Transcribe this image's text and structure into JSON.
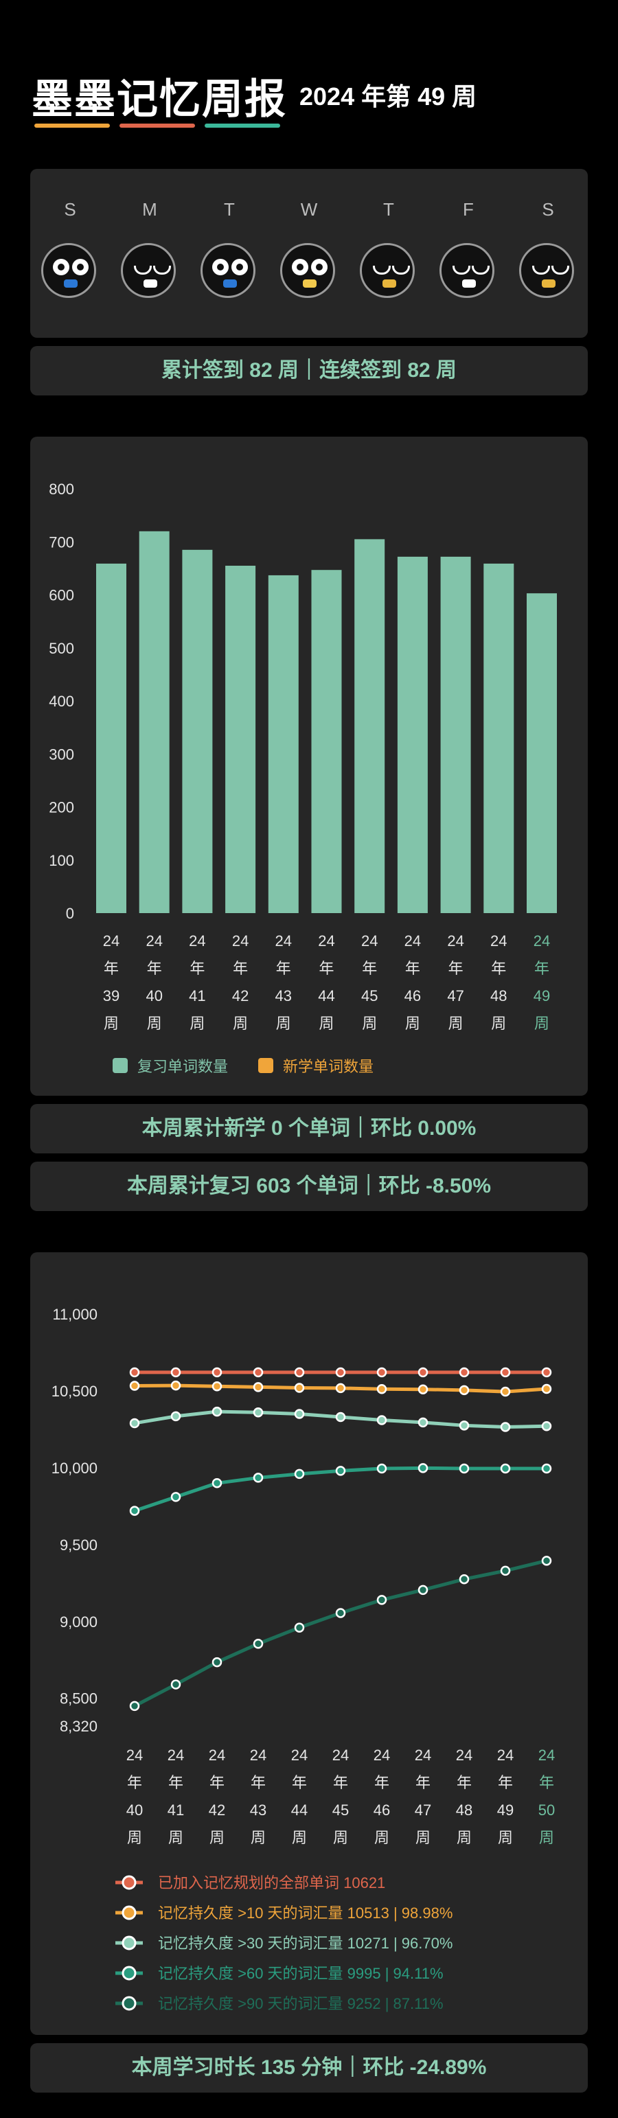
{
  "header": {
    "title": "墨墨记忆周报",
    "subtitle": "2024 年第 49 周"
  },
  "bar_colors": [
    "#f0a53a",
    "#e0664c",
    "#3bb89a"
  ],
  "week": {
    "days": [
      "S",
      "M",
      "T",
      "W",
      "T",
      "F",
      "S"
    ],
    "faces": [
      {
        "icon": "mask-face-icon",
        "eyes": "open",
        "accent": "#2b78d6"
      },
      {
        "icon": "squint-face-icon",
        "eyes": "closed",
        "accent": "#ffffff"
      },
      {
        "icon": "mask-face-icon",
        "eyes": "open",
        "accent": "#2b78d6"
      },
      {
        "icon": "wink-face-icon",
        "eyes": "open",
        "accent": "#f2c94c"
      },
      {
        "icon": "happy-face-icon",
        "eyes": "closed",
        "accent": "#e8b53c"
      },
      {
        "icon": "sleepy-face-icon",
        "eyes": "closed",
        "accent": "#ffffff"
      },
      {
        "icon": "happy-face-icon",
        "eyes": "closed",
        "accent": "#e8b53c"
      }
    ]
  },
  "streak": "累计签到 82 周｜连续签到 82 周",
  "summary_new": "本周累计新学 0 个单词｜环比 0.00%",
  "summary_review": "本周累计复习 603 个单词｜环比 -8.50%",
  "summary_time": "本周学习时长 135 分钟｜环比 -24.89%",
  "chart_data": [
    {
      "type": "bar",
      "categories": [
        "24年39周",
        "24年40周",
        "24年41周",
        "24年42周",
        "24年43周",
        "24年44周",
        "24年45周",
        "24年46周",
        "24年47周",
        "24年48周",
        "24年49周"
      ],
      "series": [
        {
          "name": "复习单词数量",
          "values": [
            659,
            720,
            685,
            655,
            637,
            647,
            705,
            672,
            672,
            659,
            603
          ],
          "color": "#82c4aa"
        },
        {
          "name": "新学单词数量",
          "values": [
            0,
            0,
            0,
            0,
            0,
            0,
            0,
            0,
            0,
            0,
            0
          ],
          "color": "#f0a53a"
        }
      ],
      "yticks": [
        0,
        100,
        200,
        300,
        400,
        500,
        600,
        700,
        800
      ],
      "ylim": [
        0,
        800
      ],
      "highlight_color": "#6fbf9f",
      "legend": "bottom"
    },
    {
      "type": "line",
      "categories": [
        "24年40周",
        "24年41周",
        "24年42周",
        "24年43周",
        "24年44周",
        "24年45周",
        "24年46周",
        "24年47周",
        "24年48周",
        "24年49周",
        "24年50周"
      ],
      "yticks": [
        8320,
        8500,
        9000,
        9500,
        10000,
        10500,
        11000
      ],
      "ytick_labels": [
        "8,320",
        "8,500",
        "9,000",
        "9,500",
        "10,000",
        "10,500",
        "11,000"
      ],
      "ylim": [
        8320,
        11000
      ],
      "series": [
        {
          "name": "已加入记忆规划的全部单词 10621",
          "values": [
            10621,
            10621,
            10621,
            10621,
            10621,
            10621,
            10621,
            10621,
            10621,
            10621,
            10621
          ],
          "color": "#e0664c"
        },
        {
          "name": "记忆持久度 >10 天的词汇量 10513 | 98.98%",
          "values": [
            10533,
            10535,
            10530,
            10525,
            10520,
            10518,
            10512,
            10510,
            10505,
            10495,
            10513
          ],
          "color": "#f0a53a"
        },
        {
          "name": "记忆持久度 >30 天的词汇量 10271 | 96.70%",
          "values": [
            10290,
            10335,
            10365,
            10360,
            10350,
            10330,
            10310,
            10295,
            10275,
            10265,
            10271
          ],
          "color": "#8fd0b8"
        },
        {
          "name": "记忆持久度 >60 天的词汇量 9995 | 94.11%",
          "values": [
            9720,
            9810,
            9900,
            9935,
            9960,
            9980,
            9995,
            9998,
            9995,
            9995,
            9995
          ],
          "color": "#2a9d80"
        },
        {
          "name": "记忆持久度 >90 天的词汇量 9252 | 87.11%",
          "values": [
            8450,
            8590,
            8735,
            8855,
            8960,
            9055,
            9140,
            9205,
            9275,
            9330,
            9395
          ],
          "color": "#1e6e58"
        }
      ],
      "highlight_color": "#6fbf9f",
      "legend": "bottom"
    }
  ]
}
